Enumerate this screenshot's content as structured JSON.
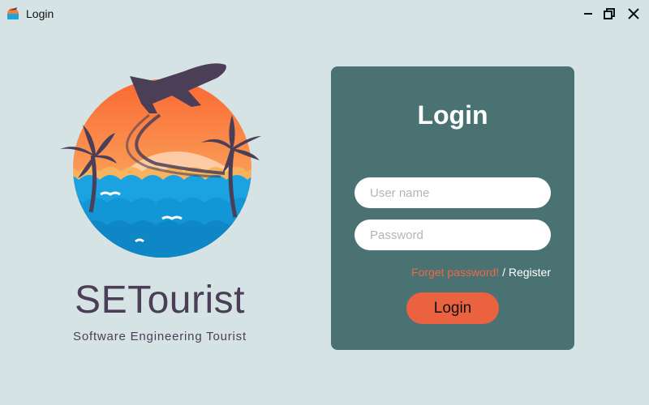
{
  "window": {
    "title": "Login"
  },
  "brand": {
    "name": "SETourist",
    "tagline": "Software Engineering Tourist",
    "colors": {
      "sun_top": "#f95d2a",
      "sun_bottom": "#fdd98a",
      "sea": "#1aa3e0",
      "silhouette": "#4a3f57"
    }
  },
  "login": {
    "title": "Login",
    "username_placeholder": "User name",
    "password_placeholder": "Password",
    "forgot_label": "Forget password!",
    "separator": " / ",
    "register_label": "Register",
    "submit_label": "Login",
    "colors": {
      "panel": "#4a7272",
      "accent": "#eb6241"
    }
  }
}
